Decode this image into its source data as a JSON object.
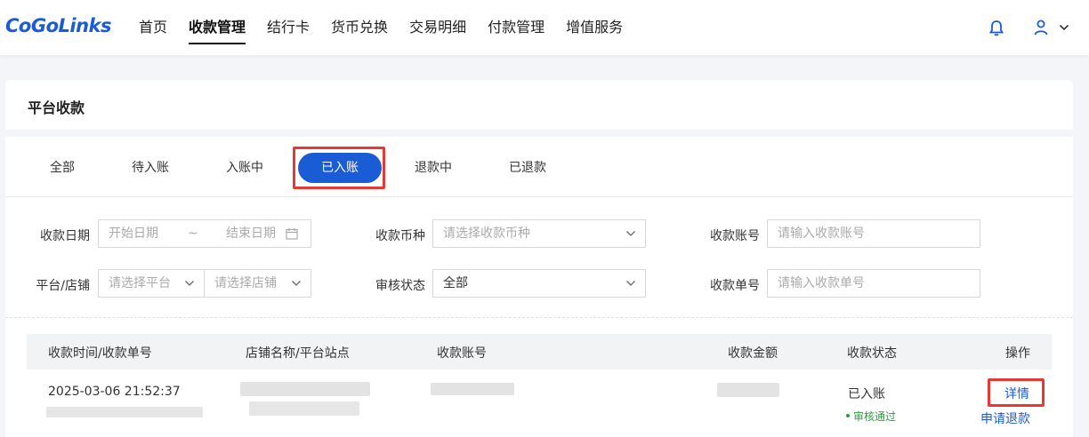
{
  "brand": {
    "logo": "CoGoLinks"
  },
  "nav": {
    "items": [
      {
        "label": "首页"
      },
      {
        "label": "收款管理",
        "active": true
      },
      {
        "label": "结行卡"
      },
      {
        "label": "货币兑换"
      },
      {
        "label": "交易明细"
      },
      {
        "label": "付款管理"
      },
      {
        "label": "增值服务"
      }
    ]
  },
  "page": {
    "title": "平台收款"
  },
  "tabs": [
    "全部",
    "待入账",
    "入账中",
    "已入账",
    "退款中",
    "已退款"
  ],
  "active_tab": "已入账",
  "filters": {
    "date_label": "收款日期",
    "date_start_ph": "开始日期",
    "date_sep": "~",
    "date_end_ph": "结束日期",
    "currency_label": "收款币种",
    "currency_ph": "请选择收款币种",
    "account_label": "收款账号",
    "account_ph": "请输入收款账号",
    "platform_label": "平台/店铺",
    "platform_ph": "请选择平台",
    "shop_ph": "请选择店铺",
    "review_label": "审核状态",
    "review_value": "全部",
    "order_label": "收款单号",
    "order_ph": "请输入收款单号"
  },
  "table": {
    "headers": [
      "收款时间/收款单号",
      "店铺名称/平台站点",
      "收款账号",
      "收款金额",
      "收款状态",
      "操作"
    ],
    "rows": [
      {
        "time": "2025-03-06 21:52:37",
        "status": "已入账",
        "review": "审核通过",
        "actions": [
          "详情",
          "申请退款"
        ]
      }
    ]
  },
  "colors": {
    "accent": "#1a5bd6",
    "highlight": "#e53935",
    "success": "#2a9d3a"
  }
}
